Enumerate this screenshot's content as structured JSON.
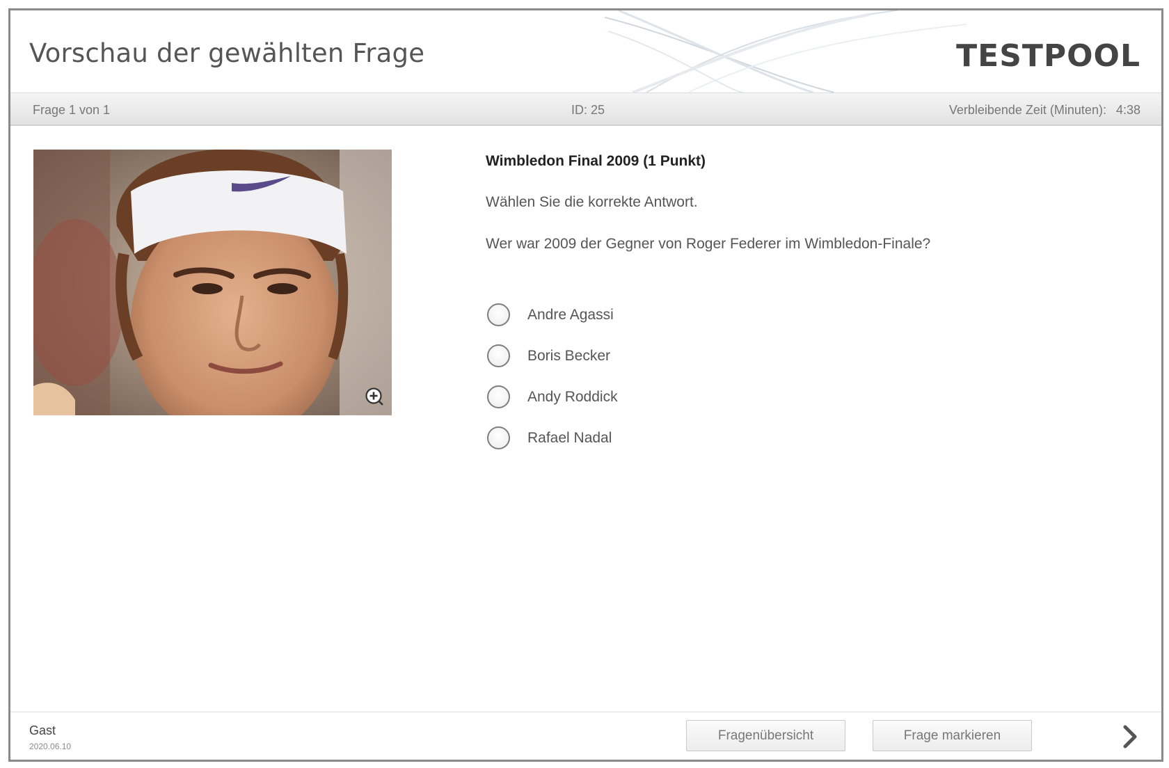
{
  "header": {
    "title": "Vorschau der gewählten Frage",
    "brand": "TESTPOOL"
  },
  "infobar": {
    "counter": "Frage 1 von 1",
    "id": "ID: 25",
    "time_label": "Verbleibende Zeit (Minuten):",
    "time_value": "4:38"
  },
  "question": {
    "title": "Wimbledon Final 2009 (1 Punkt)",
    "instruction": "Wählen Sie die korrekte Antwort.",
    "text": "Wer war 2009 der Gegner von Roger Federer im Wimbledon-Finale?",
    "answers": [
      {
        "label": "Andre Agassi"
      },
      {
        "label": "Boris Becker"
      },
      {
        "label": "Andy Roddick"
      },
      {
        "label": "Rafael Nadal"
      }
    ]
  },
  "footer": {
    "user": "Gast",
    "date": "2020.06.10",
    "overview_label": "Fragenübersicht",
    "mark_label": "Frage markieren"
  },
  "icons": {
    "zoom": "zoom-in-icon",
    "next": "chevron-right-icon",
    "radio": "radio-unchecked-icon"
  },
  "colors": {
    "frame_border": "#8a8a8a",
    "infobar_bg": "#e9e9e9",
    "text_muted": "#777777"
  }
}
